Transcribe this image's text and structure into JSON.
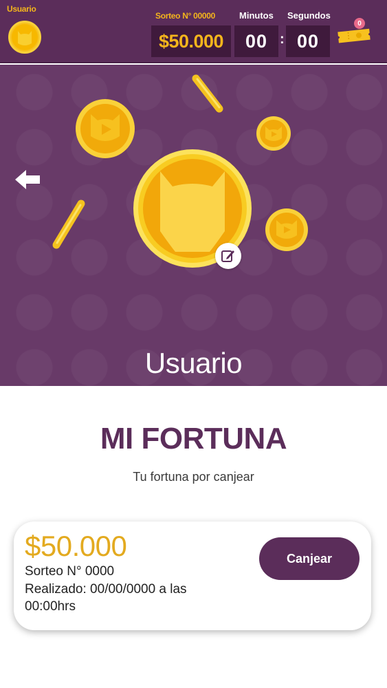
{
  "header": {
    "user_label": "Usuario",
    "draw_label": "Sorteo N° 00000",
    "prize_amount": "$50.000",
    "minutes_label": "Minutos",
    "seconds_label": "Segundos",
    "minutes_value": "00",
    "seconds_value": "00",
    "separator": ":",
    "ticket_count": "0"
  },
  "hero": {
    "user_name": "Usuario"
  },
  "main": {
    "title": "MI FORTUNA",
    "subtitle": "Tu fortuna por canjear"
  },
  "prize_card": {
    "amount": "$50.000",
    "draw_text": "Sorteo N° 0000",
    "completed_text": "Realizado: 00/00/0000 a las 00:00hrs",
    "redeem_label": "Canjear"
  },
  "icons": {
    "avatar": "cat-coin-icon",
    "ticket": "ticket-icon",
    "back": "arrow-left-icon",
    "edit": "edit-icon",
    "coin": "coin-icon"
  },
  "colors": {
    "brand_purple": "#5b2d5a",
    "hero_purple": "#683a68",
    "gold": "#f4b51c",
    "amount_gold": "#e3aa1f",
    "dark_box": "#3f1a3c",
    "badge_pink": "#e86a8a"
  }
}
